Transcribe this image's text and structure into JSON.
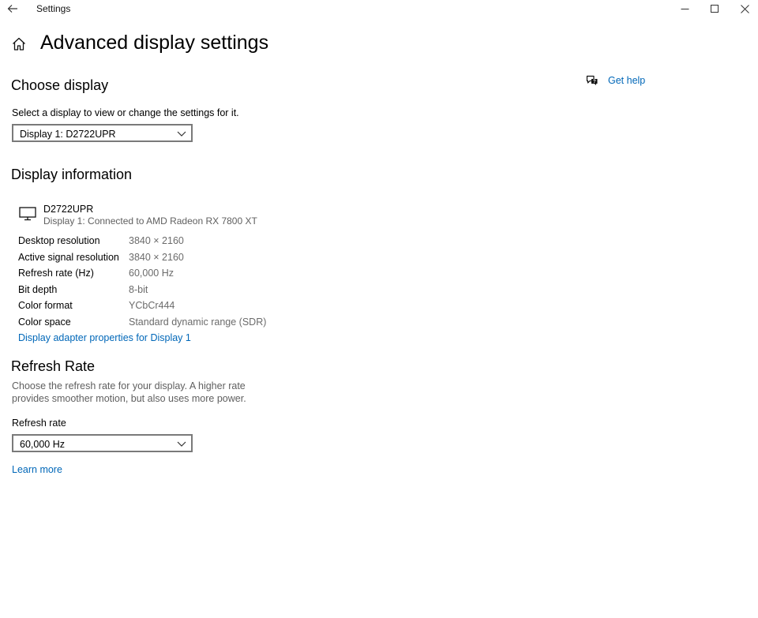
{
  "window": {
    "title": "Settings",
    "controls": {
      "minimize": "minimize-icon",
      "maximize": "maximize-icon",
      "close": "close-icon"
    }
  },
  "page": {
    "title": "Advanced display settings",
    "home_icon": "home-icon"
  },
  "help": {
    "label": "Get help",
    "icon": "chat-help-icon"
  },
  "choose_display": {
    "heading": "Choose display",
    "instruction": "Select a display to view or change the settings for it.",
    "selected": "Display 1: D2722UPR"
  },
  "display_info": {
    "heading": "Display information",
    "monitor_name": "D2722UPR",
    "monitor_subtitle": "Display 1: Connected to AMD Radeon RX 7800 XT",
    "rows": [
      {
        "label": "Desktop resolution",
        "value": "3840 × 2160"
      },
      {
        "label": "Active signal resolution",
        "value": "3840 × 2160"
      },
      {
        "label": "Refresh rate (Hz)",
        "value": "60,000 Hz"
      },
      {
        "label": "Bit depth",
        "value": "8-bit"
      },
      {
        "label": "Color format",
        "value": "YCbCr444"
      },
      {
        "label": "Color space",
        "value": "Standard dynamic range (SDR)"
      }
    ],
    "adapter_link": "Display adapter properties for Display 1"
  },
  "refresh": {
    "heading": "Refresh Rate",
    "description": "Choose the refresh rate for your display. A higher rate provides smoother motion, but also uses more power.",
    "field_label": "Refresh rate",
    "selected": "60,000 Hz",
    "learn_more": "Learn more"
  },
  "colors": {
    "accent": "#0067b8",
    "muted": "#5f5f5f",
    "border": "#7a7a7a"
  }
}
